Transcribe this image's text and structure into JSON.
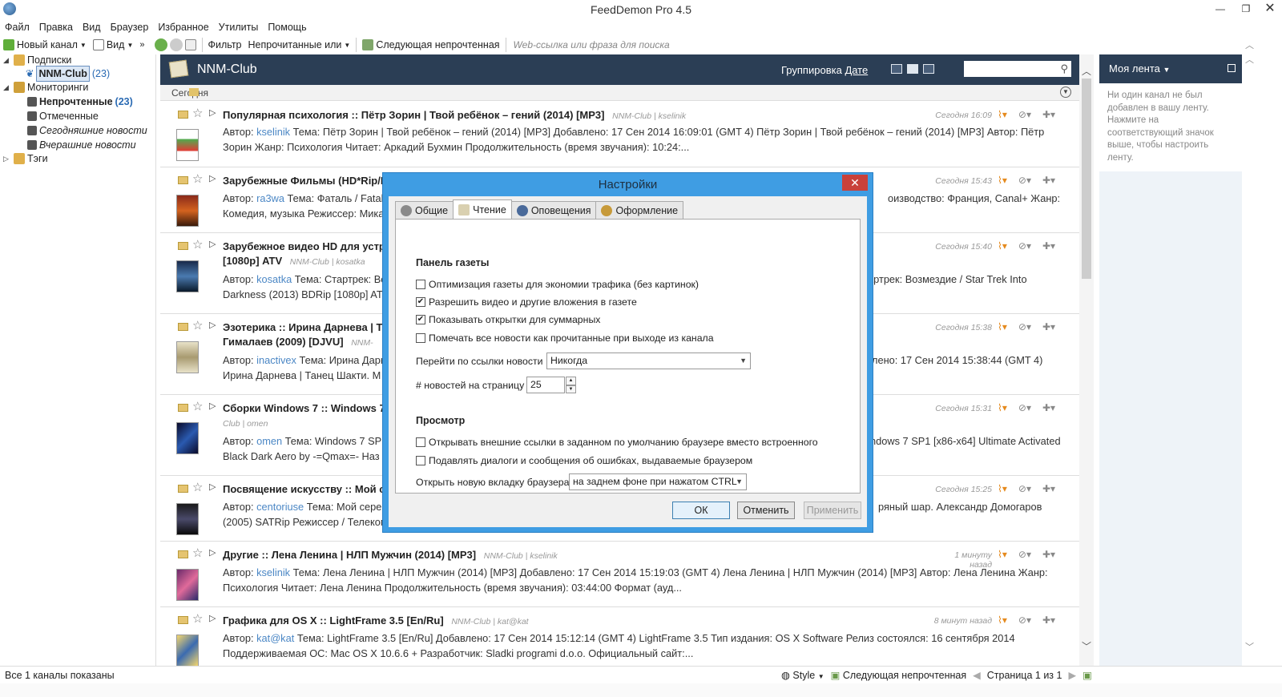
{
  "window": {
    "title": "FeedDemon Pro 4.5"
  },
  "menu": [
    "Файл",
    "Правка",
    "Вид",
    "Браузер",
    "Избранное",
    "Утилиты",
    "Помощь"
  ],
  "toolbar": {
    "new_channel": "Новый канал",
    "view": "Вид",
    "filter": "Фильтр",
    "filter_value": "Непрочитанные или",
    "next_unread": "Следующая непрочтенная",
    "search_placeholder": "Web-ссылка или фраза для поиска"
  },
  "sidebar": {
    "subscriptions": "Подписки",
    "channel": "NNM-Club",
    "channel_count": "(23)",
    "monitorings": "Мониторинги",
    "unread": "Непрочтенные",
    "unread_count": "(23)",
    "flagged": "Отмеченные",
    "today_news": "Сегодняшние новости",
    "yesterday_news": "Вчерашние новости",
    "tags": "Тэги"
  },
  "feed": {
    "name": "NNM-Club",
    "grouping_label": "Группировка",
    "grouping_value": "Дате",
    "date_group": "Сегодня"
  },
  "articles": [
    {
      "title": "Популярная психология :: Пётр Зорин | Твой ребёнок – гений (2014) [MP3]",
      "meta": "NNM-Club | kselinik",
      "time": "Сегодня 16:09",
      "author": "kselinik",
      "body": "Тема: Пётр Зорин | Твой ребёнок – гений (2014) [MP3] Добавлено: 17 Сен 2014 16:09:01 (GMT 4) Пётр Зорин | Твой ребёнок – гений (2014) [MP3] Автор: Пётр Зорин Жанр: Психология Читает: Аркадий Бухмин Продолжительность (время звучания): 10:24:..."
    },
    {
      "title": "Зарубежные Фильмы (HD*Rip/L",
      "meta": "",
      "time": "Сегодня 15:43",
      "author": "ra3wa",
      "body": "Тема: Фаталь / Fatal",
      "body_right": "оизводство: Франция, Canal+ Жанр:",
      "body2": "Комедия, музыка Режиссер: Мика"
    },
    {
      "title": "Зарубежное видео HD для устр",
      "title2": "[1080p] ATV",
      "meta": "NNM-Club | kosatka",
      "time": "Сегодня 15:40",
      "author": "kosatka",
      "body": "Тема: Стартрек: Во",
      "body_right": "артрек: Возмездие / Star Trek Into",
      "body2": "Darkness (2013) BDRip [1080p] ATV"
    },
    {
      "title": "Эзотерика :: Ирина Дарнева | Т",
      "title2": "Гималаев (2009) [DJVU]",
      "meta": "NNM-",
      "time": "Сегодня 15:38",
      "author": "inactivex",
      "body": "Тема: Ирина Дарн",
      "body_right": "лено: 17 Сен 2014 15:38:44 (GMT 4)",
      "body2": "Ирина Дарнева | Танец Шакти. М"
    },
    {
      "title": "Сборки Windows 7 :: Windows 7",
      "meta": "Club | omen",
      "time": "Сегодня 15:31",
      "author": "omen",
      "body": "Тема: Windows 7 SP",
      "body_right": "ndows 7 SP1 [x86-x64] Ultimate Activated",
      "body2": "Black Dark Aero by -=Qmax=- Наз"
    },
    {
      "title": "Посвящение искусству :: Мой се",
      "meta": "",
      "time": "Сегодня 15:25",
      "author": "centoriuse",
      "body": "Тема: Мой сере",
      "body_right": "ряный шар. Александр Домогаров",
      "body2": "(2005) SATRip Режиссер / Телеком"
    },
    {
      "title": "Другие :: Лена Ленина | НЛП Мужчин (2014) [MP3]",
      "meta": "NNM-Club | kselinik",
      "time": "1 минуту назад",
      "author": "kselinik",
      "body": "Тема: Лена Ленина | НЛП Мужчин (2014) [MP3] Добавлено: 17 Сен 2014 15:19:03 (GMT 4) Лена Ленина | НЛП Мужчин (2014) [MP3] Автор: Лена Ленина Жанр:",
      "body2": "Психология Читает: Лена Ленина Продолжительность (время звучания): 03:44:00 Формат (ауд..."
    },
    {
      "title": "Графика для OS X :: LightFrame 3.5 [En/Ru]",
      "meta": "NNM-Club | kat@kat",
      "time": "8 минут назад",
      "author": "kat@kat",
      "body": "Тема: LightFrame 3.5 [En/Ru] Добавлено: 17 Сен 2014 15:12:14 (GMT 4) LightFrame 3.5 Тип издания: OS X Software Релиз состоялся: 16 сентября 2014",
      "body2": "Поддерживаемая ОС: Mac OS X 10.6.6 + Разработчик: Sladki programi d.o.o. Официальный сайт:..."
    }
  ],
  "author_prefix": "Автор:",
  "right_pane": {
    "title": "Моя лента",
    "message": "Ни один канал не был добавлен в вашу ленту. Нажмите на соответствующий значок выше, чтобы настроить ленту."
  },
  "status": {
    "left": "Все 1 каналы показаны",
    "style": "Style",
    "next_unread": "Следующая непрочтенная",
    "page": "Страница 1 из 1"
  },
  "dialog": {
    "title": "Настройки",
    "tabs": [
      "Общие",
      "Чтение",
      "Оповещения",
      "Оформление"
    ],
    "section_newspaper": "Панель газеты",
    "opt1": "Оптимизация газеты для экономии трафика (без картинок)",
    "opt1_checked": false,
    "opt2": "Разрешить видео и другие вложения в газете",
    "opt2_checked": true,
    "opt3": "Показывать открытки для суммарных",
    "opt3_checked": true,
    "opt4": "Помечать все новости как прочитанные при выходе из канала",
    "opt4_checked": false,
    "goto_label": "Перейти по ссылки новости",
    "goto_value": "Никогда",
    "perpage_label": "# новостей на страницу",
    "perpage_value": "25",
    "section_view": "Просмотр",
    "opt5": "Открывать внешние ссылки в заданном по умолчанию браузере вместо встроенного",
    "opt5_checked": false,
    "opt6": "Подавлять диалоги и сообщения об ошибках, выдаваемые браузером",
    "opt6_checked": false,
    "newtab_label": "Открыть новую вкладку браузера",
    "newtab_value": "на заднем фоне при нажатом CTRL",
    "ok": "ОК",
    "cancel": "Отменить",
    "apply": "Применить"
  }
}
